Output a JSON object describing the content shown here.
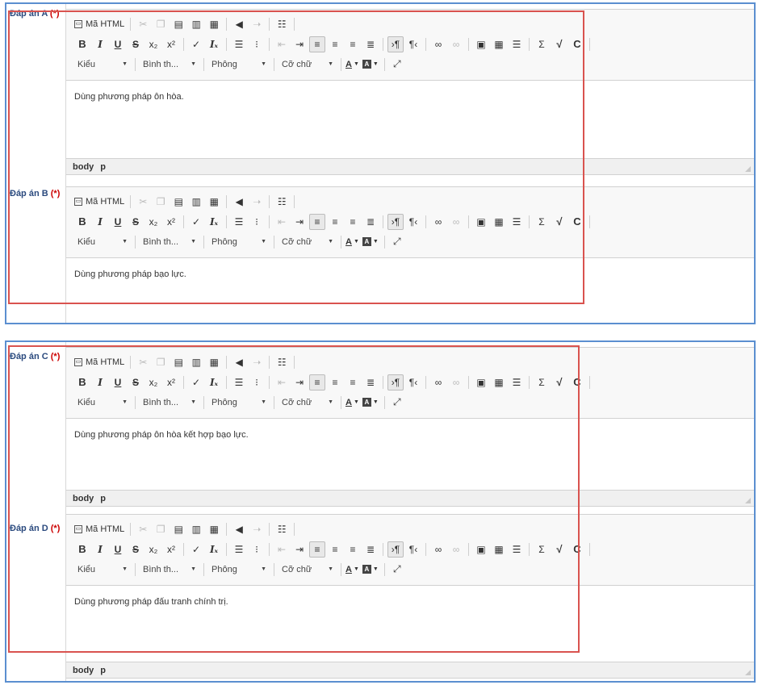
{
  "toolbar": {
    "source_label": "Mã HTML",
    "style_combo": "Kiểu",
    "format_combo": "Bình th...",
    "font_combo": "Phông",
    "size_combo": "Cỡ chữ"
  },
  "status_path": [
    "body",
    "p"
  ],
  "answers": [
    {
      "label": "Đáp án A",
      "required": "(*)",
      "content": "Dùng phương pháp ôn hòa."
    },
    {
      "label": "Đáp án B",
      "required": "(*)",
      "content": "Dùng phương pháp bạo lực."
    },
    {
      "label": "Đáp án C",
      "required": "(*)",
      "content": "Dùng phương pháp ôn hòa kết hợp bạo lực."
    },
    {
      "label": "Đáp án D",
      "required": "(*)",
      "content": "Dùng phương pháp đấu tranh chính trị."
    }
  ],
  "colors": {
    "frame_border": "#5b8fd0",
    "highlight_border": "#d9534f",
    "required_mark": "#cc0000"
  }
}
